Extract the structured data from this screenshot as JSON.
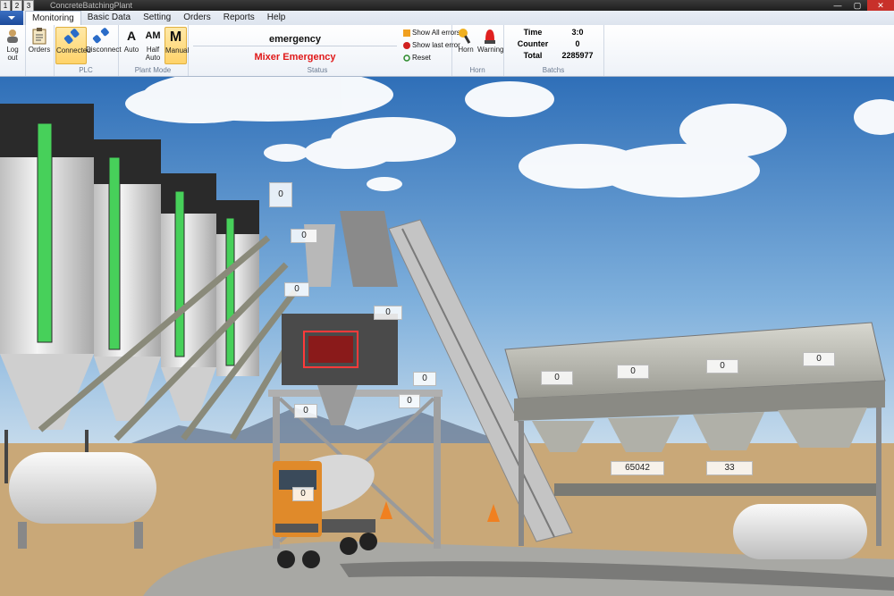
{
  "quick_access": [
    "1",
    "2",
    "3"
  ],
  "window": {
    "title": "ConcreteBatchingPlant",
    "minimize": "—",
    "maximize": "▢",
    "close": "✕"
  },
  "menu": {
    "tabs": [
      "Monitoring",
      "Basic Data",
      "Setting",
      "Orders",
      "Reports",
      "Help"
    ]
  },
  "ribbon": {
    "logout": {
      "label_line1": "Log",
      "label_line2": "out"
    },
    "orders": {
      "label": "Orders"
    },
    "plc": {
      "group_label": "PLC",
      "connected": "Connected",
      "disconnect": "Disconnect"
    },
    "plant_mode": {
      "group_label": "Plant Mode",
      "auto_letter": "A",
      "auto": "Auto",
      "half_letter": "AM",
      "half_line1": "Half",
      "half_line2": "Auto",
      "manual_letter": "M",
      "manual": "Manual"
    },
    "status": {
      "group_label": "Status",
      "title": "emergency",
      "message": "Mixer Emergency",
      "show_all": "Show All errors",
      "show_last": "Show last error",
      "reset": "Reset"
    },
    "horn": {
      "group_label": "Horn",
      "horn": "Horn",
      "warning": "Warning"
    },
    "batchs": {
      "group_label": "Batchs",
      "rows": [
        {
          "k": "Time",
          "v": "3:0"
        },
        {
          "k": "Counter",
          "v": "0"
        },
        {
          "k": "Total",
          "v": "2285977"
        }
      ]
    }
  },
  "scene": {
    "markers": {
      "weigh_top": "0",
      "weigh_mid": "0",
      "mixer_side": "0",
      "aggregate": "0",
      "truck": "0",
      "bin1": "0",
      "bin2": "0",
      "bin3": "0",
      "bin4": "0",
      "belt_a": "65042",
      "belt_b": "33",
      "hopper_small": "0",
      "conveyor": "0",
      "mixer_low": "0"
    }
  },
  "colors": {
    "sky_top": "#2f6fb8",
    "ground": "#c9a878",
    "silo_level": "#47d05a",
    "truck": "#e08a2a",
    "emergency": "#e01818"
  }
}
